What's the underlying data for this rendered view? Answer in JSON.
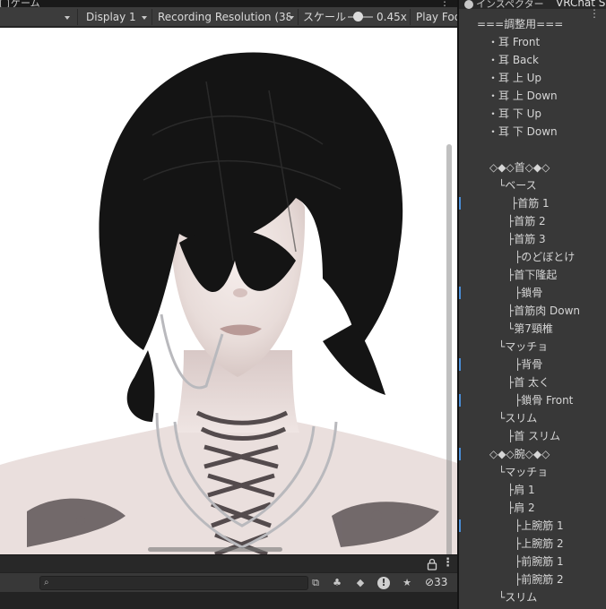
{
  "game": {
    "tab_label": "ゲーム",
    "toolbar": {
      "display": "Display 1",
      "resolution": "Recording Resolution (38",
      "scale_label": "スケール",
      "scale_value": "0.45x",
      "play_focus": "Play Foc"
    },
    "console": {
      "count": "33"
    }
  },
  "right": {
    "inspector_tab": "インスペクター",
    "vrchat_label": "VRChat S",
    "hierarchy": [
      {
        "label": "===調整用===",
        "indent": 20
      },
      {
        "label": "・耳 Front",
        "indent": 32
      },
      {
        "label": "・耳 Back",
        "indent": 32
      },
      {
        "label": "・耳 上 Up",
        "indent": 32
      },
      {
        "label": "・耳 上 Down",
        "indent": 32
      },
      {
        "label": "・耳 下 Up",
        "indent": 32
      },
      {
        "label": "・耳 下 Down",
        "indent": 32
      },
      {
        "label": "◇◆◇首◇◆◇",
        "indent": 34
      },
      {
        "label": "└ベース",
        "indent": 44
      },
      {
        "label": "├首筋 1",
        "indent": 58
      },
      {
        "label": "├首筋 2",
        "indent": 54
      },
      {
        "label": "├首筋 3",
        "indent": 54
      },
      {
        "label": "├のどぼとけ",
        "indent": 62
      },
      {
        "label": "├首下隆起",
        "indent": 54
      },
      {
        "label": "├鎖骨",
        "indent": 62
      },
      {
        "label": "├首筋肉 Down",
        "indent": 54
      },
      {
        "label": "└第7頸椎",
        "indent": 54
      },
      {
        "label": "└マッチョ",
        "indent": 44
      },
      {
        "label": "├背骨",
        "indent": 62
      },
      {
        "label": "├首 太く",
        "indent": 54
      },
      {
        "label": "├鎖骨 Front",
        "indent": 62
      },
      {
        "label": "└スリム",
        "indent": 44
      },
      {
        "label": "├首 スリム",
        "indent": 54
      },
      {
        "label": "◇◆◇腕◇◆◇",
        "indent": 34
      },
      {
        "label": "└マッチョ",
        "indent": 44
      },
      {
        "label": "├肩 1",
        "indent": 54
      },
      {
        "label": "├肩 2",
        "indent": 54
      },
      {
        "label": "├上腕筋 1",
        "indent": 62
      },
      {
        "label": "├上腕筋 2",
        "indent": 62
      },
      {
        "label": "├前腕筋 1",
        "indent": 62
      },
      {
        "label": "├前腕筋 2",
        "indent": 62
      },
      {
        "label": "└スリム",
        "indent": 44
      }
    ]
  },
  "colors": {
    "accent_mark": "#4a8ed8",
    "panel_bg": "#383838",
    "toolbar_bg": "#3c3c3c"
  }
}
